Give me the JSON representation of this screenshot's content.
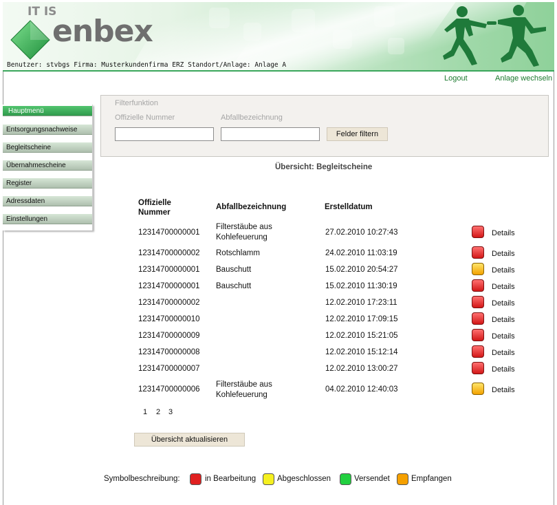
{
  "banner": {
    "logo_top": "IT IS",
    "logo_main": "enbex",
    "user_info": "Benutzer: stvbgs  Firma: Musterkundenfirma ERZ  Standort/Anlage: Anlage A"
  },
  "top_links": {
    "logout": "Logout",
    "switch_site": "Anlage wechseln"
  },
  "sidebar": {
    "items": [
      {
        "label": "Hauptmenü",
        "active": true
      },
      {
        "label": "Entsorgungsnachweise",
        "active": false
      },
      {
        "label": "Begleitscheine",
        "active": false
      },
      {
        "label": "Übernahmescheine",
        "active": false
      },
      {
        "label": "Register",
        "active": false
      },
      {
        "label": "Adressdaten",
        "active": false
      },
      {
        "label": "Einstellungen",
        "active": false
      }
    ]
  },
  "filter": {
    "legend": "Filterfunktion",
    "official_number_label": "Offizielle Nummer",
    "official_number_value": "",
    "waste_label": "Abfallbezeichnung",
    "waste_value": "",
    "filter_button": "Felder filtern"
  },
  "overview": {
    "heading": "Übersicht: Begleitscheine",
    "columns": {
      "number": "Offizielle Nummer",
      "waste": "Abfallbezeichnung",
      "created": "Erstelldatum"
    },
    "details_label": "Details",
    "rows": [
      {
        "number": "12314700000001",
        "waste": "Filterstäube aus Kohlefeuerung",
        "created": "27.02.2010 10:27:43",
        "status": "red"
      },
      {
        "number": "12314700000002",
        "waste": "Rotschlamm",
        "created": "24.02.2010 11:03:19",
        "status": "red"
      },
      {
        "number": "12314700000001",
        "waste": "Bauschutt",
        "created": "15.02.2010 20:54:27",
        "status": "orange"
      },
      {
        "number": "12314700000001",
        "waste": "Bauschutt",
        "created": "15.02.2010 11:30:19",
        "status": "red"
      },
      {
        "number": "12314700000002",
        "waste": "",
        "created": "12.02.2010 17:23:11",
        "status": "red"
      },
      {
        "number": "12314700000010",
        "waste": "",
        "created": "12.02.2010 17:09:15",
        "status": "red"
      },
      {
        "number": "12314700000009",
        "waste": "",
        "created": "12.02.2010 15:21:05",
        "status": "red"
      },
      {
        "number": "12314700000008",
        "waste": "",
        "created": "12.02.2010 15:12:14",
        "status": "red"
      },
      {
        "number": "12314700000007",
        "waste": "",
        "created": "12.02.2010 13:00:27",
        "status": "red"
      },
      {
        "number": "12314700000006",
        "waste": "Filterstäube aus Kohlefeuerung",
        "created": "04.02.2010 12:40:03",
        "status": "orange"
      }
    ],
    "pages": [
      "1",
      "2",
      "3"
    ],
    "refresh_button": "Übersicht aktualisieren"
  },
  "legend": {
    "title": "Symbolbeschreibung:",
    "items": [
      {
        "label": "in Bearbeitung",
        "color": "#e02020"
      },
      {
        "label": "Abgeschlossen",
        "color": "#f5f020"
      },
      {
        "label": "Versendet",
        "color": "#22d040"
      },
      {
        "label": "Empfangen",
        "color": "#f5a000"
      }
    ]
  }
}
